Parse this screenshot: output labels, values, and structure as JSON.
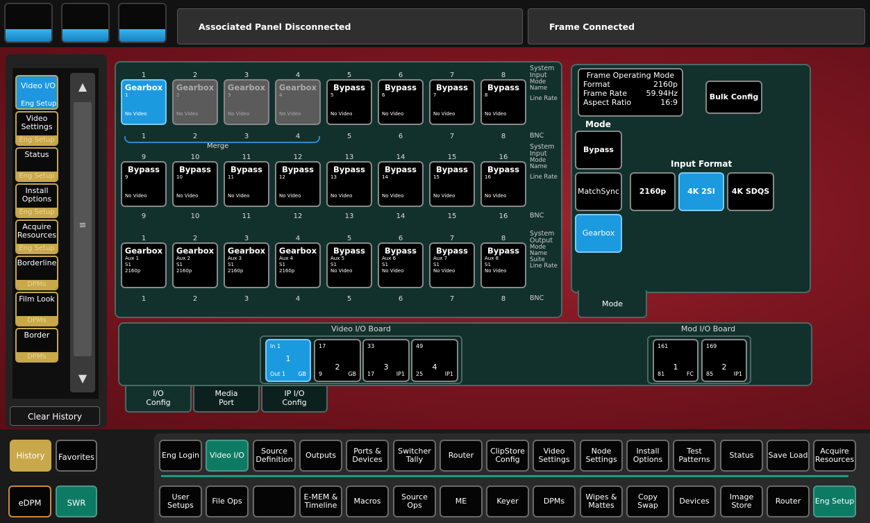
{
  "topbar": {
    "status_left": "Associated Panel Disconnected",
    "status_right": "Frame Connected"
  },
  "sidebar": {
    "items": [
      {
        "label": "Video I/O",
        "sub": "Eng Setup",
        "selected": true
      },
      {
        "label": "Video Settings",
        "sub": "Eng Setup"
      },
      {
        "label": "Status",
        "sub": "Eng Setup"
      },
      {
        "label": "Install Options",
        "sub": "Eng Setup"
      },
      {
        "label": "Acquire Resources",
        "sub": "Eng Setup"
      },
      {
        "label": "Borderline",
        "sub": "DPMs"
      },
      {
        "label": "Film Look",
        "sub": "DPMs"
      },
      {
        "label": "Border",
        "sub": "DPMs"
      }
    ],
    "clear_history": "Clear History",
    "history": "History",
    "favorites": "Favorites"
  },
  "inputs_row1": {
    "system_nums": [
      "1",
      "2",
      "3",
      "4",
      "5",
      "6",
      "7",
      "8"
    ],
    "bnc_nums": [
      "1",
      "2",
      "3",
      "4",
      "5",
      "6",
      "7",
      "8"
    ],
    "channels": [
      {
        "type": "Gearbox",
        "name": "1",
        "rate": "No Video",
        "state": "selected"
      },
      {
        "type": "Gearbox",
        "name": "2",
        "rate": "No Video",
        "state": "disabled"
      },
      {
        "type": "Gearbox",
        "name": "3",
        "rate": "No Video",
        "state": "disabled"
      },
      {
        "type": "Gearbox",
        "name": "4",
        "rate": "No Video",
        "state": "disabled"
      },
      {
        "type": "Bypass",
        "name": "5",
        "rate": "No Video",
        "state": "normal"
      },
      {
        "type": "Bypass",
        "name": "6",
        "rate": "No Video",
        "state": "normal"
      },
      {
        "type": "Bypass",
        "name": "7",
        "rate": "No Video",
        "state": "normal"
      },
      {
        "type": "Bypass",
        "name": "8",
        "rate": "No Video",
        "state": "normal"
      }
    ],
    "labels": [
      "System",
      "Input",
      "Mode",
      "Name",
      "Line Rate",
      "BNC"
    ],
    "merge": "Merge"
  },
  "inputs_row2": {
    "system_nums": [
      "9",
      "10",
      "11",
      "12",
      "13",
      "14",
      "15",
      "16"
    ],
    "bnc_nums": [
      "9",
      "10",
      "11",
      "12",
      "13",
      "14",
      "15",
      "16"
    ],
    "channels": [
      {
        "type": "Bypass",
        "name": "9",
        "rate": "No Video"
      },
      {
        "type": "Bypass",
        "name": "10",
        "rate": "No Video"
      },
      {
        "type": "Bypass",
        "name": "11",
        "rate": "No Video"
      },
      {
        "type": "Bypass",
        "name": "12",
        "rate": "No Video"
      },
      {
        "type": "Bypass",
        "name": "13",
        "rate": "No Video"
      },
      {
        "type": "Bypass",
        "name": "14",
        "rate": "No Video"
      },
      {
        "type": "Bypass",
        "name": "15",
        "rate": "No Video"
      },
      {
        "type": "Bypass",
        "name": "16",
        "rate": "No Video"
      }
    ],
    "labels": [
      "System",
      "Input",
      "Mode",
      "Name",
      "Line Rate",
      "BNC"
    ]
  },
  "outputs_row": {
    "system_nums": [
      "1",
      "2",
      "3",
      "4",
      "5",
      "6",
      "7",
      "8"
    ],
    "bnc_nums": [
      "1",
      "2",
      "3",
      "4",
      "5",
      "6",
      "7",
      "8"
    ],
    "channels": [
      {
        "type": "Gearbox",
        "name": "Aux 1",
        "suite": "S1",
        "rate": "2160p"
      },
      {
        "type": "Gearbox",
        "name": "Aux 2",
        "suite": "S1",
        "rate": "2160p"
      },
      {
        "type": "Gearbox",
        "name": "Aux 3",
        "suite": "S1",
        "rate": "2160p"
      },
      {
        "type": "Gearbox",
        "name": "Aux 4",
        "suite": "S1",
        "rate": "2160p"
      },
      {
        "type": "Bypass",
        "name": "Aux 5",
        "suite": "S1",
        "rate": "No Video"
      },
      {
        "type": "Bypass",
        "name": "Aux 6",
        "suite": "S1",
        "rate": "No Video"
      },
      {
        "type": "Bypass",
        "name": "Aux 7",
        "suite": "S1",
        "rate": "No Video"
      },
      {
        "type": "Bypass",
        "name": "Aux 8",
        "suite": "S1",
        "rate": "No Video"
      }
    ],
    "labels": [
      "System",
      "Output",
      "Mode",
      "Name",
      "Suite",
      "Line Rate",
      "BNC"
    ]
  },
  "frame_mode": {
    "title": "Frame Operating Mode",
    "format_label": "Format",
    "format_value": "2160p",
    "rate_label": "Frame Rate",
    "rate_value": "59.94Hz",
    "aspect_label": "Aspect Ratio",
    "aspect_value": "16:9",
    "bulk_config": "Bulk Config",
    "mode_label": "Mode",
    "modes": [
      "Bypass",
      "MatchSync",
      "Gearbox"
    ],
    "input_format_label": "Input Format",
    "input_formats": [
      "2160p",
      "4K 2SI",
      "4K SDQS"
    ],
    "tab": "Mode"
  },
  "boards": {
    "video_title": "Video I/O Board",
    "mod_title": "Mod I/O Board",
    "video": [
      {
        "top": "In 1",
        "c1": "1",
        "bl": "Out 1",
        "br": "GB",
        "selected": true
      },
      {
        "top": "17",
        "c1": "2",
        "bl": "9",
        "br": "GB"
      },
      {
        "top": "33",
        "c1": "3",
        "bl": "17",
        "br": "IP1"
      },
      {
        "top": "49",
        "c1": "4",
        "bl": "25",
        "br": "IP1"
      }
    ],
    "mod": [
      {
        "top": "161",
        "c1": "1",
        "bl": "81",
        "br": "FC"
      },
      {
        "top": "169",
        "c1": "2",
        "bl": "85",
        "br": "IP1"
      }
    ]
  },
  "config_tabs": [
    {
      "l1": "I/O",
      "l2": "Config"
    },
    {
      "l1": "Media",
      "l2": "Port"
    },
    {
      "l1": "IP I/O",
      "l2": "Config"
    }
  ],
  "nav_row1": [
    "Eng Login",
    "Video I/O",
    "Source Definition",
    "Outputs",
    "Ports & Devices",
    "Switcher Tally",
    "Router",
    "ClipStore Config",
    "Video Settings",
    "Node Settings",
    "Install Options",
    "Test Patterns",
    "Status",
    "Save Load",
    "Acquire Resources"
  ],
  "nav_row2": [
    "User Setups",
    "File Ops",
    "",
    "E-MEM & Timeline",
    "Macros",
    "Source Ops",
    "ME",
    "Keyer",
    "DPMs",
    "Wipes & Mattes",
    "Copy Swap",
    "Devices",
    "Image Store",
    "Router",
    "Eng Setup"
  ],
  "bottom_left": {
    "edpm": "eDPM",
    "swr": "SWR"
  }
}
